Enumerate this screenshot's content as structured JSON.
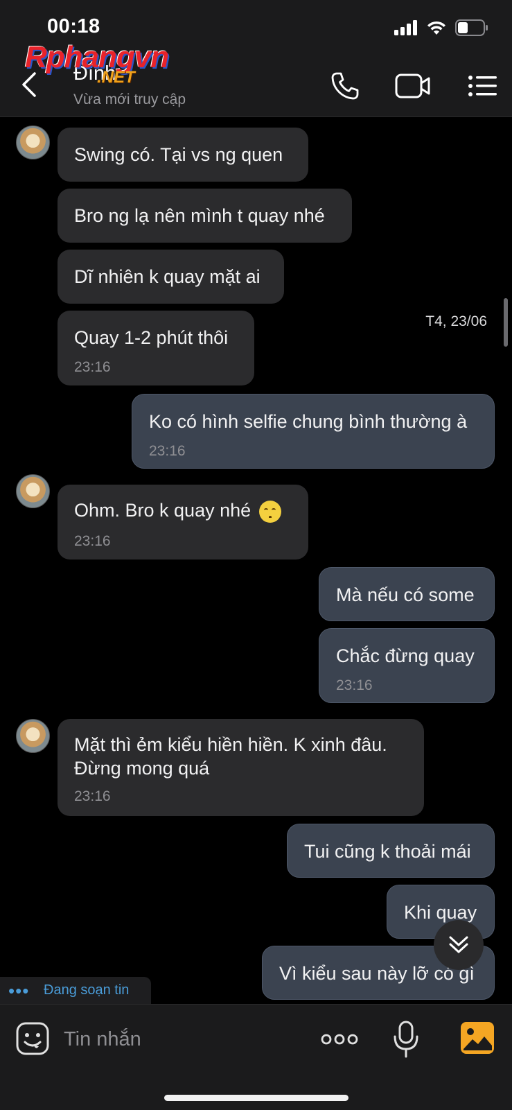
{
  "status_bar": {
    "time": "00:18"
  },
  "watermark": {
    "main": "Rphangvn",
    "suffix": ".NET"
  },
  "header": {
    "contact_name": "Đình",
    "contact_status": "Vừa mới truy cập",
    "icons": [
      "back-chevron-icon",
      "phone-icon",
      "video-camera-icon",
      "list-menu-icon"
    ]
  },
  "chat": {
    "date_separator": "T4, 23/06",
    "messages": [
      {
        "dir": "in",
        "text": "Swing có. Tại vs ng quen"
      },
      {
        "dir": "in",
        "text": "Bro ng lạ nên mình t quay nhé"
      },
      {
        "dir": "in",
        "text": "Dĩ nhiên k quay mặt ai"
      },
      {
        "dir": "in",
        "text": "Quay 1-2 phút thôi",
        "time": "23:16"
      },
      {
        "dir": "out",
        "text": "Ko có hình selfie chung bình thường à",
        "time": "23:16"
      },
      {
        "dir": "in",
        "text": "Ohm. Bro k quay nhé",
        "emoji": "relieved-smile-emoji",
        "time": "23:16"
      },
      {
        "dir": "out",
        "text": "Mà nếu có some"
      },
      {
        "dir": "out",
        "text": "Chắc đừng quay",
        "time": "23:16"
      },
      {
        "dir": "in",
        "text_line1": "Mặt thì ẻm kiểu hiền hiền. K xinh đâu.",
        "text_line2": "Đừng mong quá",
        "time": "23:16"
      },
      {
        "dir": "out",
        "text": "Tui cũng k thoải mái"
      },
      {
        "dir": "out",
        "text": "Khi quay"
      },
      {
        "dir": "out",
        "text": "Vì kiểu sau này lỡ có gì"
      }
    ]
  },
  "typing_indicator": {
    "label": "Đang soạn tin"
  },
  "composer": {
    "placeholder": "Tin nhắn",
    "icons": [
      "sticker-face-icon",
      "more-dots-icon",
      "microphone-icon",
      "image-gallery-icon"
    ]
  },
  "colors": {
    "background": "#000000",
    "bar": "#1b1b1c",
    "incoming_bubble": "#2b2b2d",
    "outgoing_bubble": "#3b4350",
    "accent_blue": "#4a9cd8",
    "gallery_orange": "#f5a623"
  }
}
